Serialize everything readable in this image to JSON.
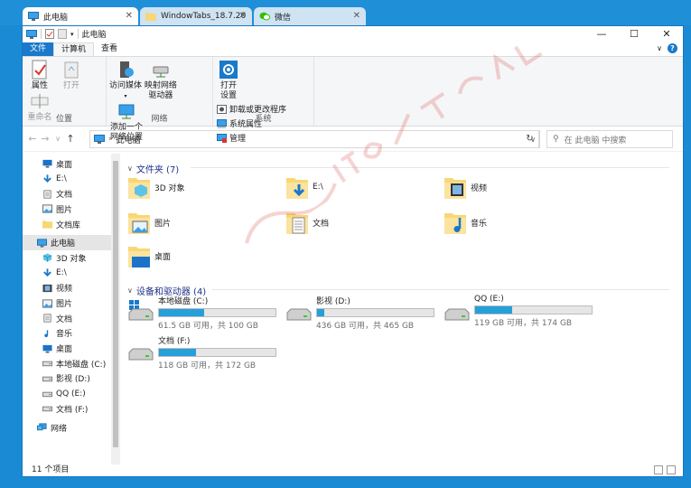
{
  "tabs": [
    {
      "label": "此电脑",
      "icon": "computer-icon"
    },
    {
      "label": "WindowTabs_18.7.20",
      "icon": "folder-icon"
    },
    {
      "label": "微信",
      "icon": "wechat-icon"
    }
  ],
  "title": "此电脑",
  "window_controls": {
    "minimize": "—",
    "maximize": "☐",
    "close": "✕"
  },
  "menu": {
    "file": "文件",
    "computer": "计算机",
    "view": "查看"
  },
  "ribbon": {
    "location": {
      "label": "位置",
      "properties": "属性",
      "open": "打开",
      "rename": "重命名"
    },
    "network": {
      "label": "网络",
      "access_media": "访问媒体",
      "map_drive": "映射网络\n驱动器",
      "add_location": "添加一个\n网络位置"
    },
    "system": {
      "label": "系统",
      "open_settings": "打开\n设置",
      "uninstall": "卸载或更改程序",
      "sys_props": "系统属性",
      "manage": "管理"
    }
  },
  "address": {
    "path": "此电脑",
    "search_placeholder": "在 此电脑 中搜索"
  },
  "nav": {
    "quick": [
      {
        "label": "桌面",
        "icon": "desktop-icon",
        "pinned": true
      },
      {
        "label": "E:\\",
        "icon": "download-icon",
        "pinned": true
      },
      {
        "label": "文档",
        "icon": "document-icon",
        "pinned": true
      },
      {
        "label": "图片",
        "icon": "picture-icon",
        "pinned": true
      },
      {
        "label": "文档库",
        "icon": "folder-icon",
        "pinned": true
      }
    ],
    "thispc": "此电脑",
    "pc_items": [
      {
        "label": "3D 对象",
        "icon": "3d-icon"
      },
      {
        "label": "E:\\",
        "icon": "download-icon"
      },
      {
        "label": "视频",
        "icon": "video-icon"
      },
      {
        "label": "图片",
        "icon": "picture-icon"
      },
      {
        "label": "文档",
        "icon": "document-icon"
      },
      {
        "label": "音乐",
        "icon": "music-icon"
      },
      {
        "label": "桌面",
        "icon": "desktop-icon"
      },
      {
        "label": "本地磁盘 (C:)",
        "icon": "drive-icon"
      },
      {
        "label": "影视 (D:)",
        "icon": "drive-icon"
      },
      {
        "label": "QQ (E:)",
        "icon": "drive-icon"
      },
      {
        "label": "文档 (F:)",
        "icon": "drive-icon"
      }
    ],
    "network": "网络"
  },
  "folders_header": "文件夹 (7)",
  "folders": [
    {
      "label": "3D 对象",
      "icon": "3d-icon"
    },
    {
      "label": "E:\\",
      "icon": "download-icon"
    },
    {
      "label": "视频",
      "icon": "video-icon"
    },
    {
      "label": "图片",
      "icon": "picture-icon"
    },
    {
      "label": "文档",
      "icon": "document-icon"
    },
    {
      "label": "音乐",
      "icon": "music-icon"
    },
    {
      "label": "桌面",
      "icon": "desktop-icon"
    }
  ],
  "drives_header": "设备和驱动器 (4)",
  "drives": [
    {
      "label": "本地磁盘 (C:)",
      "free": "61.5 GB 可用，共 100 GB",
      "used_fraction": 0.385,
      "icon": "windows-drive-icon"
    },
    {
      "label": "影视 (D:)",
      "free": "436 GB 可用，共 465 GB",
      "used_fraction": 0.062,
      "icon": "drive-icon"
    },
    {
      "label": "QQ (E:)",
      "free": "119 GB 可用，共 174 GB",
      "used_fraction": 0.316,
      "icon": "drive-icon"
    },
    {
      "label": "文档 (F:)",
      "free": "118 GB 可用，共 172 GB",
      "used_fraction": 0.314,
      "icon": "drive-icon"
    }
  ],
  "status": "11 个项目",
  "watermark": "记得收藏:黑域基地 Hybase.com",
  "colors": {
    "accent": "#1979ca",
    "bar_fill": "#26a0da",
    "folder": "#f8d775"
  }
}
